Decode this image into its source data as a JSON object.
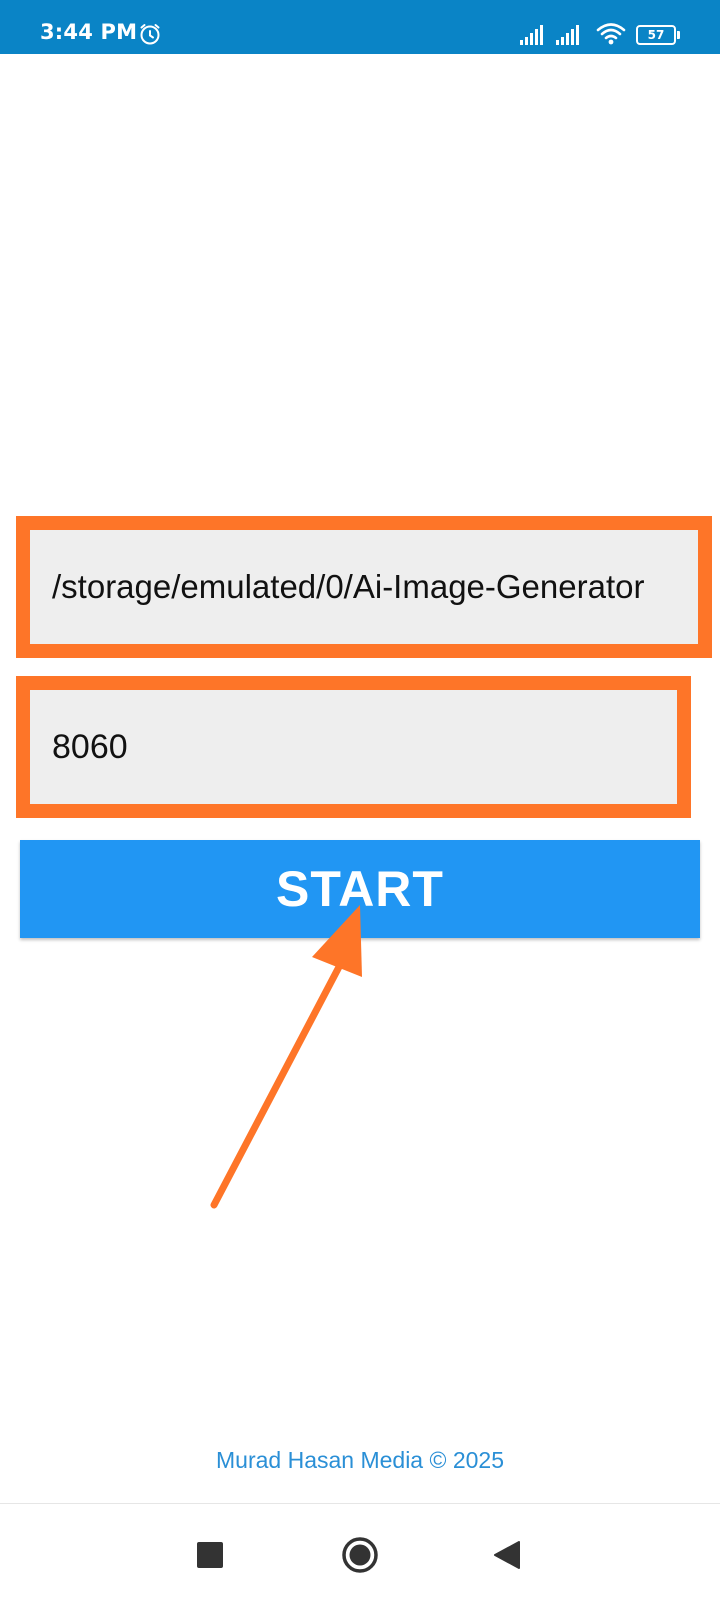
{
  "status_bar": {
    "time": "3:44 PM",
    "battery_level": "57",
    "icons": [
      "alarm-icon",
      "signal-icon",
      "signal-icon",
      "wifi-icon",
      "battery-icon"
    ],
    "background_color": "#0a84c6"
  },
  "form": {
    "path_value": "/storage/emulated/0/Ai-Image-Generator",
    "port_value": "8060",
    "start_label": "START",
    "highlight_color": "#fe7528",
    "button_color": "#2196f3"
  },
  "annotation": {
    "type": "arrow",
    "points_to": "start-button",
    "color": "#fe7528"
  },
  "footer": {
    "credit": "Murad Hasan Media © 2025"
  },
  "nav_bar": {
    "buttons": [
      "recents-button",
      "home-button",
      "back-button"
    ]
  }
}
